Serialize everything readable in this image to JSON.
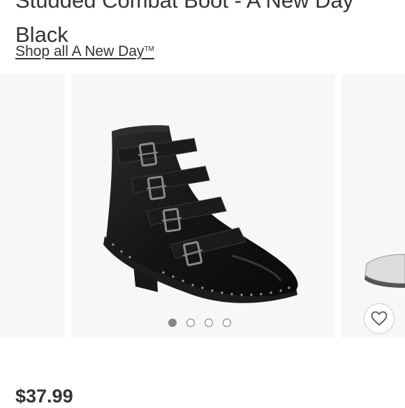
{
  "product": {
    "title_line1": "Studded Combat Boot - A New Day",
    "title_line2": "Black",
    "shop_link": "Shop all A New Day",
    "shop_link_mark": "TM",
    "price": "$37.99"
  },
  "carousel": {
    "image_count": 4,
    "active_index": 0
  },
  "icons": {
    "favorite": "heart-icon"
  },
  "colors": {
    "text": "#333333",
    "image_bg": "#f7f7f7",
    "dot_active": "#888888"
  }
}
